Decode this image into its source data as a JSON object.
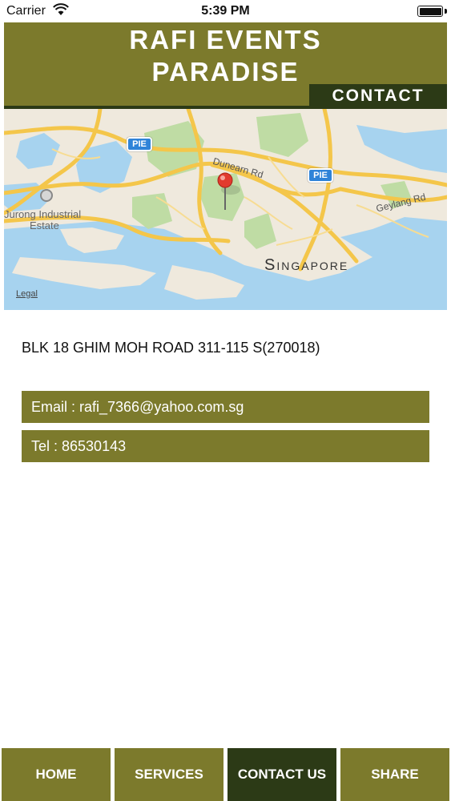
{
  "status_bar": {
    "carrier": "Carrier",
    "time": "5:39 PM",
    "battery_level_percent": 100
  },
  "header": {
    "title_line1": "RAFI EVENTS",
    "title_line2": "PARADISE",
    "section": "CONTACT"
  },
  "map": {
    "labels": {
      "road_1": "Dunearn Rd",
      "road_2": "Geylang Rd",
      "expressway_1": "PIE",
      "expressway_2": "PIE",
      "area_1": "Jurong Industrial",
      "area_1b": "Estate",
      "city": "Singapore"
    },
    "legal": "Legal"
  },
  "address": "BLK 18 GHIM MOH ROAD 311-115 S(270018)",
  "contact": {
    "email": "Email : rafi_7366@yahoo.com.sg",
    "tel": "Tel : 86530143"
  },
  "tabs": [
    {
      "label": "HOME"
    },
    {
      "label": "SERVICES"
    },
    {
      "label": "CONTACT US"
    },
    {
      "label": "SHARE"
    }
  ],
  "colors": {
    "olive": "#7c7a2c",
    "dark_green": "#2c3a16",
    "map_water": "#a7d3ef",
    "map_road": "#f4c64a"
  }
}
